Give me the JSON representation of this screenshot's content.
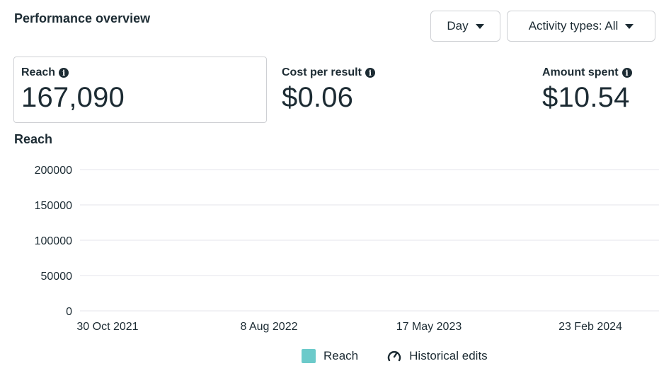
{
  "header": {
    "title": "Performance overview",
    "day_label": "Day",
    "activity_label": "Activity types: All"
  },
  "metrics": [
    {
      "label": "Reach",
      "value": "167,090"
    },
    {
      "label": "Cost per result",
      "value": "$0.06"
    },
    {
      "label": "Amount spent",
      "value": "$10.54"
    }
  ],
  "chart_section": {
    "title": "Reach"
  },
  "chart_data": {
    "type": "line",
    "title": "Reach",
    "ylim": [
      0,
      200000
    ],
    "y_ticks": [
      "200000",
      "150000",
      "100000",
      "50000",
      "0"
    ],
    "x_ticks": [
      "30 Oct 2021",
      "8 Aug 2022",
      "17 May 2023",
      "23 Feb 2024"
    ],
    "grid": true,
    "legend_placement": "bottom",
    "series": [
      {
        "name": "Reach",
        "values": []
      }
    ],
    "colors": {
      "reach": "#6ccaca",
      "grid": "#e4e6eb"
    }
  },
  "legend": {
    "reach": "Reach",
    "historical": "Historical edits"
  }
}
